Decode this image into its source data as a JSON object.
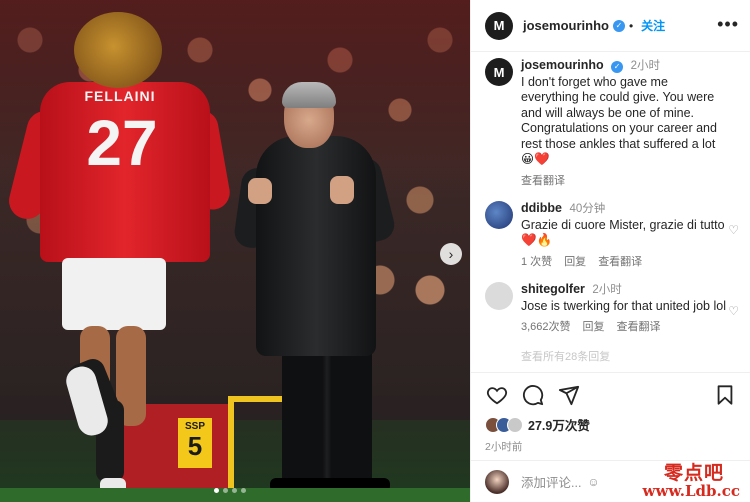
{
  "post": {
    "author": "josemourinho",
    "avatar_letter": "M",
    "follow_label": "关注",
    "more_label": "•••",
    "caption": {
      "author": "josemourinho",
      "time": "2小时",
      "text": "I don't forget who gave me everything he could give. You were and will always be one of mine. Congratulations on your career and rest those ankles that suffered a lot",
      "emojis": "😀❤️",
      "translate": "查看翻译"
    },
    "comments": [
      {
        "author": "ddibbe",
        "time": "40分钟",
        "text": "Grazie di cuore Mister, grazie di tutto",
        "emojis": "❤️🔥",
        "likes": "1 次赞",
        "reply": "回复",
        "translate": "查看翻译"
      },
      {
        "author": "shitegolfer",
        "time": "2小时",
        "text": "Jose is twerking for that united job lol",
        "emojis": "",
        "likes": "3,662次赞",
        "reply": "回复",
        "translate": "查看翻译"
      }
    ],
    "more_replies": "查看所有28条回复",
    "likes_total": "27.9万次赞",
    "posted_ago": "2小时前",
    "add_comment_placeholder": "添加评论...",
    "photo": {
      "jersey_name": "FELLAINI",
      "jersey_number": "27",
      "board_label": "SSP",
      "board_number": "5"
    }
  },
  "watermark": {
    "cn": "零点吧",
    "url": "www.Ldb.cc"
  },
  "colors": {
    "accent": "#0095f6",
    "verified": "#3897f0",
    "heart": "#ed4956",
    "jersey_red": "#e2252b"
  },
  "icons": [
    "heart-icon",
    "comment-icon",
    "share-icon",
    "bookmark-icon",
    "verified-icon",
    "more-icon",
    "next-arrow-icon",
    "emoji-icon"
  ]
}
